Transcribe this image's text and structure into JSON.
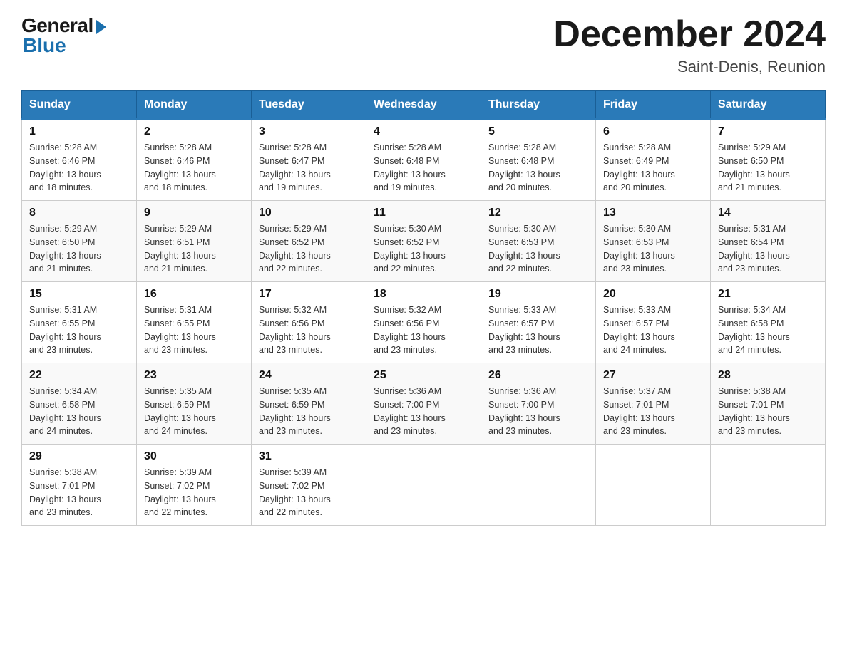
{
  "logo": {
    "general": "General",
    "blue": "Blue"
  },
  "title": "December 2024",
  "subtitle": "Saint-Denis, Reunion",
  "days": {
    "headers": [
      "Sunday",
      "Monday",
      "Tuesday",
      "Wednesday",
      "Thursday",
      "Friday",
      "Saturday"
    ]
  },
  "weeks": [
    {
      "cells": [
        {
          "day": "1",
          "sunrise": "5:28 AM",
          "sunset": "6:46 PM",
          "daylight": "13 hours and 18 minutes."
        },
        {
          "day": "2",
          "sunrise": "5:28 AM",
          "sunset": "6:46 PM",
          "daylight": "13 hours and 18 minutes."
        },
        {
          "day": "3",
          "sunrise": "5:28 AM",
          "sunset": "6:47 PM",
          "daylight": "13 hours and 19 minutes."
        },
        {
          "day": "4",
          "sunrise": "5:28 AM",
          "sunset": "6:48 PM",
          "daylight": "13 hours and 19 minutes."
        },
        {
          "day": "5",
          "sunrise": "5:28 AM",
          "sunset": "6:48 PM",
          "daylight": "13 hours and 20 minutes."
        },
        {
          "day": "6",
          "sunrise": "5:28 AM",
          "sunset": "6:49 PM",
          "daylight": "13 hours and 20 minutes."
        },
        {
          "day": "7",
          "sunrise": "5:29 AM",
          "sunset": "6:50 PM",
          "daylight": "13 hours and 21 minutes."
        }
      ]
    },
    {
      "cells": [
        {
          "day": "8",
          "sunrise": "5:29 AM",
          "sunset": "6:50 PM",
          "daylight": "13 hours and 21 minutes."
        },
        {
          "day": "9",
          "sunrise": "5:29 AM",
          "sunset": "6:51 PM",
          "daylight": "13 hours and 21 minutes."
        },
        {
          "day": "10",
          "sunrise": "5:29 AM",
          "sunset": "6:52 PM",
          "daylight": "13 hours and 22 minutes."
        },
        {
          "day": "11",
          "sunrise": "5:30 AM",
          "sunset": "6:52 PM",
          "daylight": "13 hours and 22 minutes."
        },
        {
          "day": "12",
          "sunrise": "5:30 AM",
          "sunset": "6:53 PM",
          "daylight": "13 hours and 22 minutes."
        },
        {
          "day": "13",
          "sunrise": "5:30 AM",
          "sunset": "6:53 PM",
          "daylight": "13 hours and 23 minutes."
        },
        {
          "day": "14",
          "sunrise": "5:31 AM",
          "sunset": "6:54 PM",
          "daylight": "13 hours and 23 minutes."
        }
      ]
    },
    {
      "cells": [
        {
          "day": "15",
          "sunrise": "5:31 AM",
          "sunset": "6:55 PM",
          "daylight": "13 hours and 23 minutes."
        },
        {
          "day": "16",
          "sunrise": "5:31 AM",
          "sunset": "6:55 PM",
          "daylight": "13 hours and 23 minutes."
        },
        {
          "day": "17",
          "sunrise": "5:32 AM",
          "sunset": "6:56 PM",
          "daylight": "13 hours and 23 minutes."
        },
        {
          "day": "18",
          "sunrise": "5:32 AM",
          "sunset": "6:56 PM",
          "daylight": "13 hours and 23 minutes."
        },
        {
          "day": "19",
          "sunrise": "5:33 AM",
          "sunset": "6:57 PM",
          "daylight": "13 hours and 23 minutes."
        },
        {
          "day": "20",
          "sunrise": "5:33 AM",
          "sunset": "6:57 PM",
          "daylight": "13 hours and 24 minutes."
        },
        {
          "day": "21",
          "sunrise": "5:34 AM",
          "sunset": "6:58 PM",
          "daylight": "13 hours and 24 minutes."
        }
      ]
    },
    {
      "cells": [
        {
          "day": "22",
          "sunrise": "5:34 AM",
          "sunset": "6:58 PM",
          "daylight": "13 hours and 24 minutes."
        },
        {
          "day": "23",
          "sunrise": "5:35 AM",
          "sunset": "6:59 PM",
          "daylight": "13 hours and 24 minutes."
        },
        {
          "day": "24",
          "sunrise": "5:35 AM",
          "sunset": "6:59 PM",
          "daylight": "13 hours and 23 minutes."
        },
        {
          "day": "25",
          "sunrise": "5:36 AM",
          "sunset": "7:00 PM",
          "daylight": "13 hours and 23 minutes."
        },
        {
          "day": "26",
          "sunrise": "5:36 AM",
          "sunset": "7:00 PM",
          "daylight": "13 hours and 23 minutes."
        },
        {
          "day": "27",
          "sunrise": "5:37 AM",
          "sunset": "7:01 PM",
          "daylight": "13 hours and 23 minutes."
        },
        {
          "day": "28",
          "sunrise": "5:38 AM",
          "sunset": "7:01 PM",
          "daylight": "13 hours and 23 minutes."
        }
      ]
    },
    {
      "cells": [
        {
          "day": "29",
          "sunrise": "5:38 AM",
          "sunset": "7:01 PM",
          "daylight": "13 hours and 23 minutes."
        },
        {
          "day": "30",
          "sunrise": "5:39 AM",
          "sunset": "7:02 PM",
          "daylight": "13 hours and 22 minutes."
        },
        {
          "day": "31",
          "sunrise": "5:39 AM",
          "sunset": "7:02 PM",
          "daylight": "13 hours and 22 minutes."
        },
        null,
        null,
        null,
        null
      ]
    }
  ],
  "labels": {
    "sunrise": "Sunrise:",
    "sunset": "Sunset:",
    "daylight": "Daylight:"
  }
}
